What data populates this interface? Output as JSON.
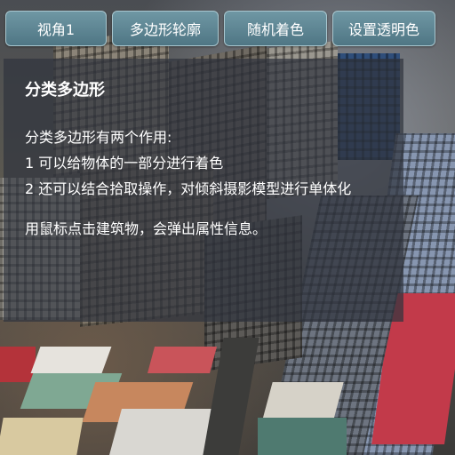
{
  "toolbar": {
    "buttons": [
      {
        "label": "视角1"
      },
      {
        "label": "多边形轮廓"
      },
      {
        "label": "随机着色"
      },
      {
        "label": "设置透明色"
      }
    ]
  },
  "panel": {
    "title": "分类多边形",
    "intro": "分类多边形有两个作用:",
    "line1": "1 可以给物体的一部分进行着色",
    "line2": "2 还可以结合拾取操作，对倾斜摄影模型进行单体化",
    "hint": "用鼠标点击建筑物，会弹出属性信息。"
  },
  "colors": {
    "button_bg": "#5f8794",
    "button_border": "#a9c7cf",
    "panel_bg": "rgba(48,53,63,0.72)",
    "text": "#ffffff"
  }
}
